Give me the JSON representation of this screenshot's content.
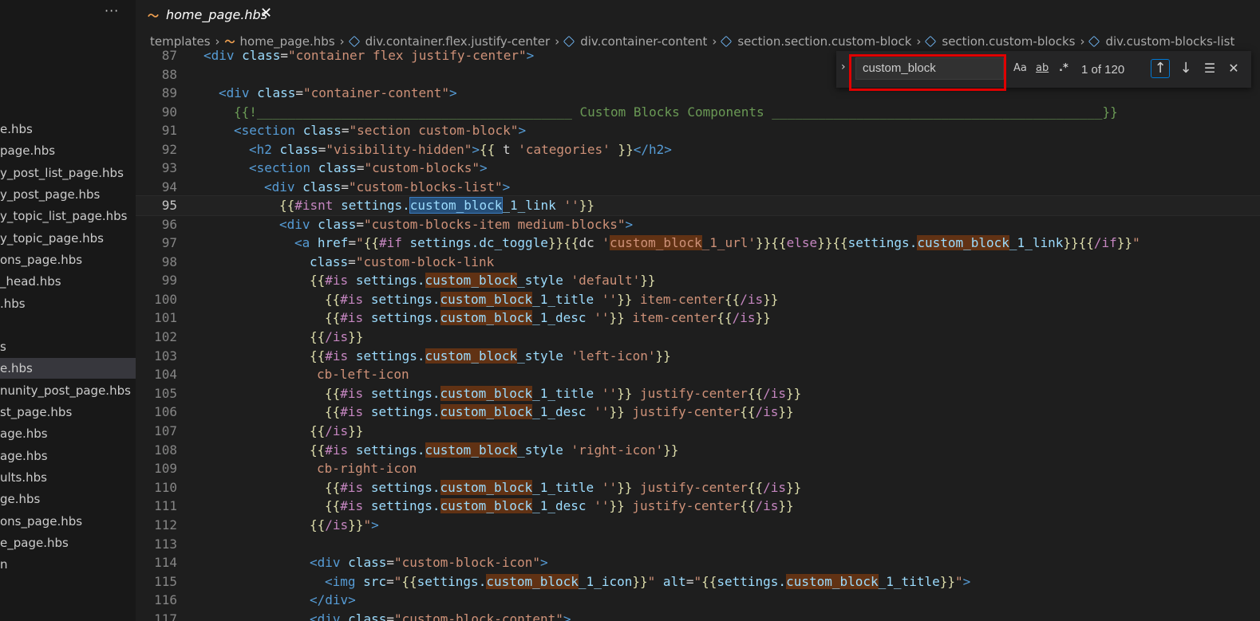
{
  "window": {
    "more_label": "···"
  },
  "tab": {
    "name": "home_page.hbs",
    "icon": "handlebars-file-icon",
    "close": "✕"
  },
  "sidebar": {
    "items": [
      {
        "label": "e.hbs"
      },
      {
        "label": "page.hbs"
      },
      {
        "label": "y_post_list_page.hbs"
      },
      {
        "label": "y_post_page.hbs"
      },
      {
        "label": "y_topic_list_page.hbs"
      },
      {
        "label": "y_topic_page.hbs"
      },
      {
        "label": "ons_page.hbs"
      },
      {
        "label": "_head.hbs"
      },
      {
        "label": ".hbs"
      },
      {
        "label": ""
      },
      {
        "label": "s"
      },
      {
        "label": "e.hbs"
      },
      {
        "label": "nunity_post_page.hbs"
      },
      {
        "label": "st_page.hbs"
      },
      {
        "label": "age.hbs"
      },
      {
        "label": "age.hbs"
      },
      {
        "label": "ults.hbs"
      },
      {
        "label": "ge.hbs"
      },
      {
        "label": "ons_page.hbs"
      },
      {
        "label": "e_page.hbs"
      },
      {
        "label": "n"
      }
    ]
  },
  "breadcrumb": {
    "items": [
      "templates",
      "home_page.hbs",
      "div.container.flex.justify-center",
      "div.container-content",
      "section.section.custom-block",
      "section.custom-blocks",
      "div.custom-blocks-list"
    ]
  },
  "find": {
    "toggle": "›",
    "value": "custom_block",
    "match_case": "Aa",
    "whole_word": "ab",
    "regex": ".*",
    "count": "1 of 120",
    "prev": "↑",
    "next": "↓",
    "selection": "☰",
    "close": "✕"
  },
  "editor": {
    "current_line": "95",
    "lines": [
      {
        "n": "87"
      },
      {
        "n": "88"
      },
      {
        "n": "89"
      },
      {
        "n": "90"
      },
      {
        "n": "91"
      },
      {
        "n": "92"
      },
      {
        "n": "93"
      },
      {
        "n": "94"
      },
      {
        "n": "95"
      },
      {
        "n": "96"
      },
      {
        "n": "97"
      },
      {
        "n": "98"
      },
      {
        "n": "99"
      },
      {
        "n": "100"
      },
      {
        "n": "101"
      },
      {
        "n": "102"
      },
      {
        "n": "103"
      },
      {
        "n": "104"
      },
      {
        "n": "105"
      },
      {
        "n": "106"
      },
      {
        "n": "107"
      },
      {
        "n": "108"
      },
      {
        "n": "109"
      },
      {
        "n": "110"
      },
      {
        "n": "111"
      },
      {
        "n": "112"
      },
      {
        "n": "113"
      },
      {
        "n": "114"
      },
      {
        "n": "115"
      },
      {
        "n": "116"
      },
      {
        "n": "117"
      }
    ]
  }
}
